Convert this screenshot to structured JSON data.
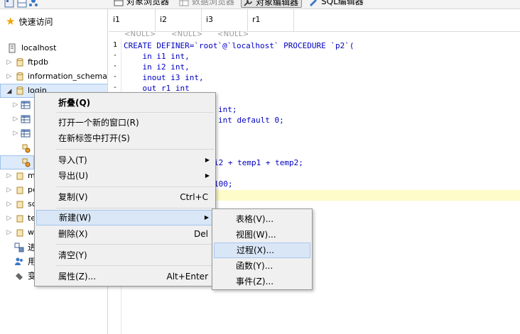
{
  "toolbar": {
    "object_browser": "对象浏览器",
    "data_browser": "数据浏览器",
    "object_editor": "对象编辑器",
    "sql_editor": "SQL编辑器"
  },
  "sidebar": {
    "quick_access": "快速访问",
    "items": [
      {
        "label": "localhost",
        "icon": "server-icon"
      },
      {
        "label": "ftpdb",
        "icon": "database-icon"
      },
      {
        "label": "information_schema",
        "icon": "database-icon"
      },
      {
        "label": "login",
        "icon": "database-icon"
      },
      {
        "label": "",
        "icon": "table-icon"
      },
      {
        "label": "",
        "icon": "table-icon"
      },
      {
        "label": "",
        "icon": "table-icon"
      },
      {
        "label": "",
        "icon": "procedure-icon"
      },
      {
        "label": "",
        "icon": "procedure-icon"
      },
      {
        "label": "m",
        "icon": "database-icon"
      },
      {
        "label": "pe",
        "icon": "database-icon"
      },
      {
        "label": "sc",
        "icon": "database-icon"
      },
      {
        "label": "te",
        "icon": "database-icon"
      },
      {
        "label": "w",
        "icon": "database-icon"
      },
      {
        "label": "进",
        "icon": "process-icon"
      },
      {
        "label": "用",
        "icon": "users-icon"
      },
      {
        "label": "变",
        "icon": "variables-icon"
      }
    ]
  },
  "grid": {
    "columns": [
      "i1",
      "i2",
      "i3",
      "r1"
    ],
    "null_text": "<NULL>"
  },
  "editor": {
    "gutter": [
      "1",
      "·",
      "·",
      "·",
      "-"
    ],
    "lines": [
      "CREATE DEFINER=`root`@`localhost` PROCEDURE `p2`(",
      "    in i1 int,",
      "    in i2 int,",
      "    inout i3 int,",
      "    out r1 int"
    ],
    "fragments": [
      "int;",
      "int default 0;",
      "i2 + temp1 + temp2;",
      "100;"
    ]
  },
  "context_menu": {
    "items": [
      {
        "label": "折叠(Q)",
        "shortcut": "",
        "submenu": false
      },
      {
        "label": "打开一个新的窗口(R)",
        "shortcut": "",
        "submenu": false
      },
      {
        "label": "在新标签中打开(S)",
        "shortcut": "",
        "submenu": false
      },
      {
        "label": "导入(T)",
        "shortcut": "",
        "submenu": true
      },
      {
        "label": "导出(U)",
        "shortcut": "",
        "submenu": true
      },
      {
        "label": "复制(V)",
        "shortcut": "Ctrl+C",
        "submenu": false
      },
      {
        "label": "新建(W)",
        "shortcut": "",
        "submenu": true
      },
      {
        "label": "删除(X)",
        "shortcut": "Del",
        "submenu": false
      },
      {
        "label": "清空(Y)",
        "shortcut": "",
        "submenu": false
      },
      {
        "label": "属性(Z)...",
        "shortcut": "Alt+Enter",
        "submenu": false
      }
    ]
  },
  "submenu": {
    "items": [
      "表格(V)...",
      "视图(W)...",
      "过程(X)...",
      "函数(Y)...",
      "事件(Z)..."
    ]
  },
  "colors": {
    "selection": "#dceafb",
    "menu_background": "#f0f0f0",
    "highlight_line": "#fefcc8",
    "keyword": "#0000c0"
  }
}
